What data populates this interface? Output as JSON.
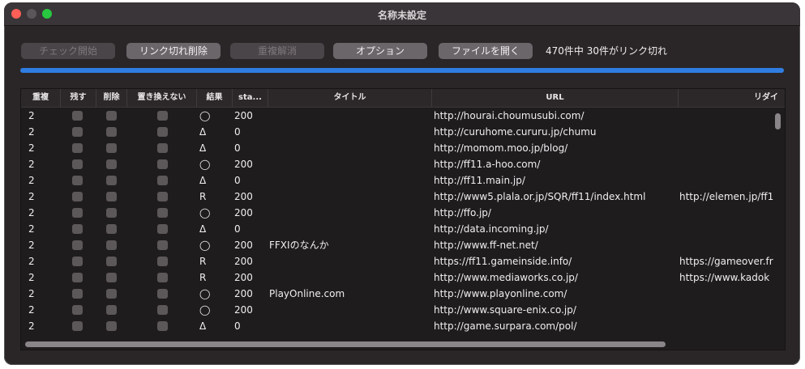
{
  "window": {
    "title": "名称未設定"
  },
  "toolbar": {
    "check_start": "チェック開始",
    "delete_broken": "リンク切れ削除",
    "dedupe": "重複解消",
    "options": "オプション",
    "open_file": "ファイルを開く",
    "status": "470件中 30件がリンク切れ"
  },
  "progress": {
    "value": 1.0,
    "color": "#2f7de1"
  },
  "table": {
    "columns": [
      "重複",
      "残す",
      "削除",
      "置き換えない",
      "結果",
      "sta...",
      "タイトル",
      "URL",
      "リダイ"
    ],
    "rows": [
      {
        "dup": "2",
        "result": "◯",
        "status": "200",
        "title": "",
        "url": "http://hourai.choumusubi.com/",
        "redirect": ""
      },
      {
        "dup": "2",
        "result": "Δ",
        "status": "0",
        "title": "",
        "url": "http://curuhome.cururu.jp/chumu",
        "redirect": ""
      },
      {
        "dup": "2",
        "result": "Δ",
        "status": "0",
        "title": "",
        "url": "http://momom.moo.jp/blog/",
        "redirect": ""
      },
      {
        "dup": "2",
        "result": "◯",
        "status": "200",
        "title": "",
        "url": "http://ff11.a-hoo.com/",
        "redirect": ""
      },
      {
        "dup": "2",
        "result": "Δ",
        "status": "0",
        "title": "",
        "url": "http://ff11.main.jp/",
        "redirect": ""
      },
      {
        "dup": "2",
        "result": "R",
        "status": "200",
        "title": "",
        "url": "http://www5.plala.or.jp/SQR/ff11/index.html",
        "redirect": "http://elemen.jp/ff1"
      },
      {
        "dup": "2",
        "result": "◯",
        "status": "200",
        "title": "",
        "url": "http://ffo.jp/",
        "redirect": ""
      },
      {
        "dup": "2",
        "result": "Δ",
        "status": "0",
        "title": "",
        "url": "http://data.incoming.jp/",
        "redirect": ""
      },
      {
        "dup": "2",
        "result": "◯",
        "status": "200",
        "title": "FFXIのなんか",
        "url": "http://www.ff-net.net/",
        "redirect": ""
      },
      {
        "dup": "2",
        "result": "R",
        "status": "200",
        "title": "",
        "url": "https://ff11.gameinside.info/",
        "redirect": "https://gameover.fr"
      },
      {
        "dup": "2",
        "result": "R",
        "status": "200",
        "title": "",
        "url": "http://www.mediaworks.co.jp/",
        "redirect": "https://www.kadok"
      },
      {
        "dup": "2",
        "result": "◯",
        "status": "200",
        "title": "PlayOnline.com",
        "url": "http://www.playonline.com/",
        "redirect": ""
      },
      {
        "dup": "2",
        "result": "◯",
        "status": "200",
        "title": "",
        "url": "http://www.square-enix.co.jp/",
        "redirect": ""
      },
      {
        "dup": "2",
        "result": "Δ",
        "status": "0",
        "title": "",
        "url": "http://game.surpara.com/pol/",
        "redirect": ""
      }
    ]
  }
}
